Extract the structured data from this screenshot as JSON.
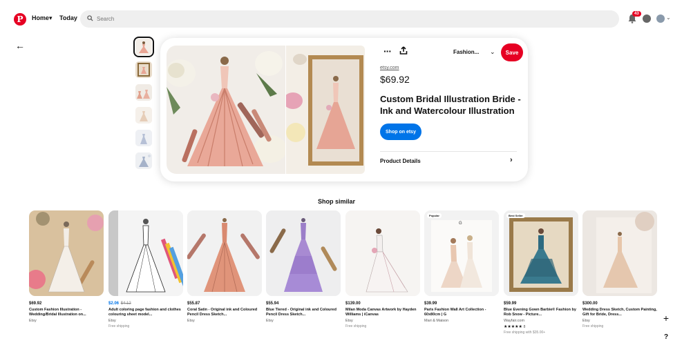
{
  "nav": {
    "home_label": "Home",
    "home_caret": "▾",
    "today_label": "Today",
    "search_placeholder": "Search",
    "notification_count": "43"
  },
  "pin": {
    "more_label": "···",
    "board_name": "Fashion...",
    "save_label": "Save",
    "source": "etsy.com",
    "price": "$69.92",
    "title": "Custom Bridal Illustration Bride - Ink and Watercolour Illustration",
    "shop_label": "Shop on etsy",
    "details_label": "Product Details"
  },
  "section_title": "Shop similar",
  "products": [
    {
      "price": "$69.92",
      "title": "Custom Fashion Illustration - Wedding/Bridal Illustration on...",
      "seller": "Etsy",
      "shipping": ""
    },
    {
      "price": "$2.06",
      "orig_price": "$4.12",
      "title": "Adult coloring page fashion and clothes colouring sheet model...",
      "seller": "Etsy",
      "shipping": "Free shipping"
    },
    {
      "price": "$55.87",
      "title": "Coral Satin - Original ink and Coloured Pencil Dress Sketch...",
      "seller": "Etsy",
      "shipping": ""
    },
    {
      "price": "$55.94",
      "title": "Blue Tiered - Original ink and Coloured Pencil Dress Sketch...",
      "seller": "Etsy",
      "shipping": ""
    },
    {
      "price": "$139.00",
      "title": "Milan Moda Canvas Artwork by Hayden Williams | iCanvas",
      "seller": "Etsy",
      "shipping": "Free shipping"
    },
    {
      "price": "$39.99",
      "title": "Paris Fashion Wall Art Collection - 60x80cm | G",
      "seller": "Mari & Maison",
      "shipping": "",
      "tag": "Popular",
      "img_letter": "G"
    },
    {
      "price": "$59.99",
      "title": "Blue Evening Gown Barbie® Fashion by Rob Snow - Picture...",
      "seller": "Wayfair.com",
      "stars": "★★★★★",
      "rating_count": "8",
      "shipping": "Free shipping with $35.00+",
      "tag": "Best Seller"
    },
    {
      "price": "$300.00",
      "title": "Wedding Dress Sketch, Custom Painting, Gift for Bride, Dress...",
      "seller": "Etsy",
      "shipping": "Free shipping"
    }
  ],
  "colors": {
    "brand_red": "#e60023",
    "shop_blue": "#0074e8"
  }
}
